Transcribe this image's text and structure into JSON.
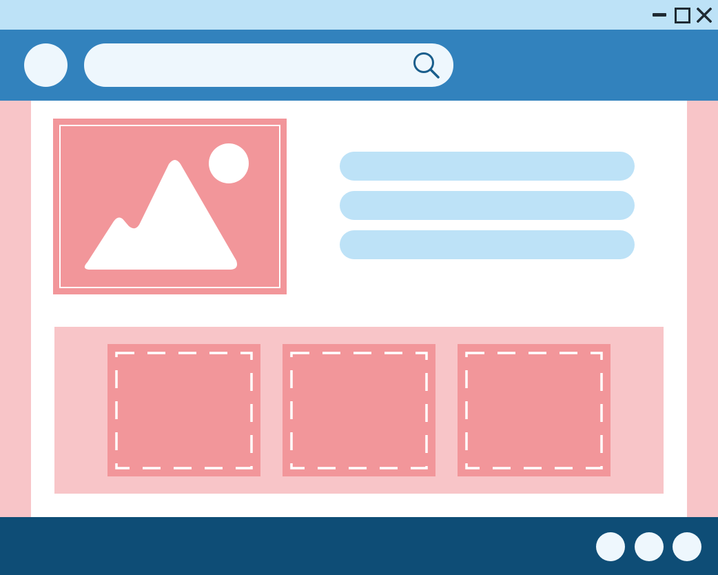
{
  "window": {
    "controls": [
      {
        "name": "minimize-icon"
      },
      {
        "name": "maximize-icon"
      },
      {
        "name": "close-icon"
      }
    ]
  },
  "colors": {
    "titlebar": "#bde2f7",
    "navbar": "#3282bd",
    "accent_pink": "#f2969a",
    "light_pink": "#f8c5c8",
    "light_blue": "#bde2f7",
    "footer": "#0e4d76",
    "icon_dark": "#1f2a33"
  },
  "navbar": {
    "avatar_icon": "avatar-circle",
    "search": {
      "value": "",
      "placeholder": "",
      "icon": "search-icon"
    }
  },
  "hero": {
    "image_icon": "image-placeholder-icon",
    "text_lines": 3
  },
  "gallery": {
    "tiles": [
      {
        "icon": "dashed-placeholder"
      },
      {
        "icon": "dashed-placeholder"
      },
      {
        "icon": "dashed-placeholder"
      }
    ]
  },
  "footer": {
    "dots": 3
  }
}
